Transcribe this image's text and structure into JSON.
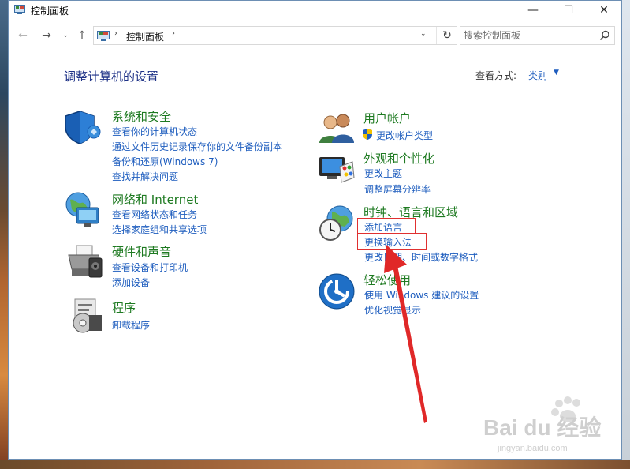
{
  "window": {
    "title": "控制面板",
    "controls": {
      "minimize": "—",
      "maximize": "☐",
      "close": "✕"
    }
  },
  "nav": {
    "back": "←",
    "forward": "→",
    "recent": "⌄",
    "up": "↑",
    "address_separator": "›",
    "address": "控制面板",
    "dropdown": "⌄",
    "refresh": "↻",
    "search_placeholder": "搜索控制面板"
  },
  "header": {
    "title": "调整计算机的设置",
    "view_by_label": "查看方式:",
    "view_by_value": "类别",
    "view_by_caret": "▼"
  },
  "categories_left": [
    {
      "title": "系统和安全",
      "icon": "shield-icon",
      "links": [
        "查看你的计算机状态",
        "通过文件历史记录保存你的文件备份副本",
        "备份和还原(Windows 7)",
        "查找并解决问题"
      ]
    },
    {
      "title": "网络和 Internet",
      "icon": "network-globe-icon",
      "links": [
        "查看网络状态和任务",
        "选择家庭组和共享选项"
      ]
    },
    {
      "title": "硬件和声音",
      "icon": "printer-icon",
      "links": [
        "查看设备和打印机",
        "添加设备"
      ]
    },
    {
      "title": "程序",
      "icon": "programs-disc-icon",
      "links": [
        "卸载程序"
      ]
    }
  ],
  "categories_right": [
    {
      "title": "用户帐户",
      "icon": "users-icon",
      "links": [
        "更改帐户类型"
      ]
    },
    {
      "title": "外观和个性化",
      "icon": "monitor-palette-icon",
      "links": [
        "更改主题",
        "调整屏幕分辨率"
      ]
    },
    {
      "title": "时钟、语言和区域",
      "icon": "clock-globe-icon",
      "links": [
        "添加语言",
        "更换输入法",
        "更改日期、时间或数字格式"
      ]
    },
    {
      "title": "轻松使用",
      "icon": "ease-of-access-icon",
      "links": [
        "使用 Windows 建议的设置",
        "优化视觉显示"
      ]
    }
  ],
  "colors": {
    "category_title": "#1e7a21",
    "link": "#1e5dbe",
    "page_title": "#1e3287",
    "annotation": "#e03030"
  },
  "watermark": {
    "brand": "Bai du 经验",
    "url": "jingyan.baidu.com"
  }
}
